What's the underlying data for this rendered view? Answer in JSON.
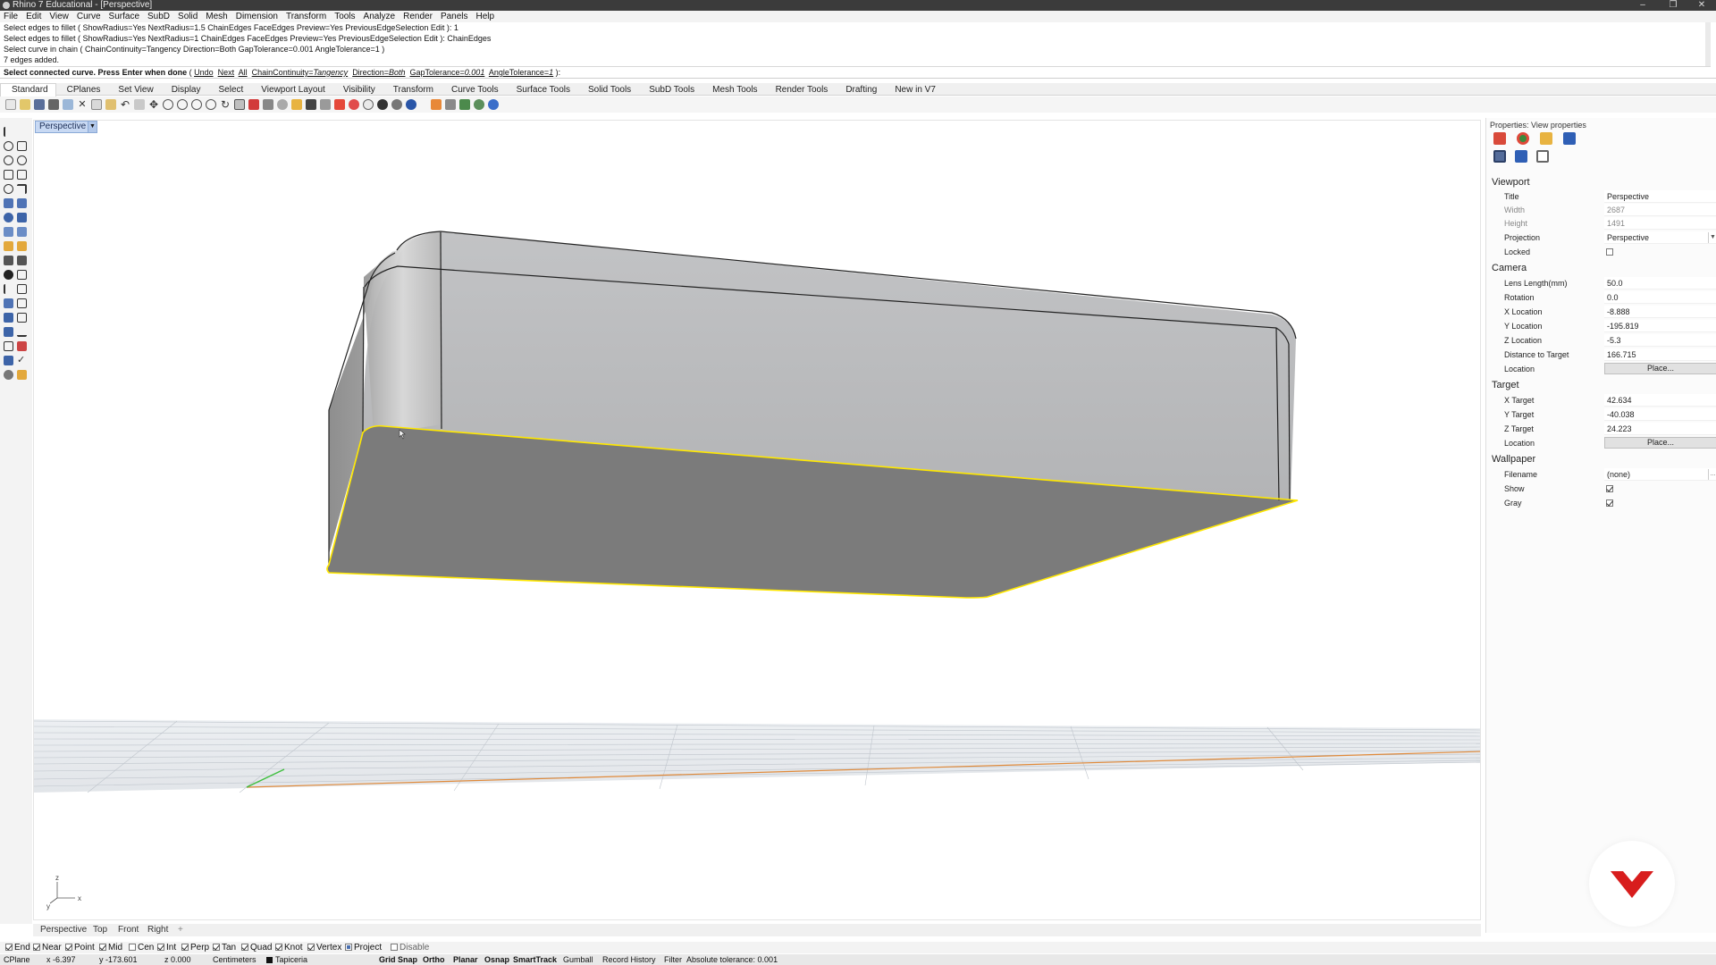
{
  "titlebar": {
    "title": "Rhino 7 Educational - [Perspective]"
  },
  "menu": [
    "File",
    "Edit",
    "View",
    "Curve",
    "Surface",
    "SubD",
    "Solid",
    "Mesh",
    "Dimension",
    "Transform",
    "Tools",
    "Analyze",
    "Render",
    "Panels",
    "Help"
  ],
  "command_history": [
    "Select edges to fillet ( ShowRadius=Yes  NextRadius=1.5  ChainEdges  FaceEdges  Preview=Yes  PreviousEdgeSelection  Edit ): 1",
    "Select edges to fillet ( ShowRadius=Yes  NextRadius=1  ChainEdges  FaceEdges  Preview=Yes  PreviousEdgeSelection  Edit ): ChainEdges",
    "Select curve in chain ( ChainContinuity=Tangency  Direction=Both  GapTolerance=0.001  AngleTolerance=1 )",
    "7 edges added."
  ],
  "command_prompt": {
    "prefix": "Select connected curve. Press Enter when done",
    "opt_undo": "Undo",
    "opt_next": "Next",
    "opt_all": "All",
    "opt_chain": "ChainContinuity=",
    "chain_val": "Tangency",
    "opt_dir": "Direction=",
    "dir_val": "Both",
    "opt_gap": "GapTolerance=",
    "gap_val": "0.001",
    "opt_angle": "AngleTolerance=",
    "angle_val": "1",
    "suffix": " ):"
  },
  "tool_tabs": [
    "Standard",
    "CPlanes",
    "Set View",
    "Display",
    "Select",
    "Viewport Layout",
    "Visibility",
    "Transform",
    "Curve Tools",
    "Surface Tools",
    "Solid Tools",
    "SubD Tools",
    "Mesh Tools",
    "Render Tools",
    "Drafting",
    "New in V7"
  ],
  "viewport": {
    "title": "Perspective",
    "axis_x": "x",
    "axis_y": "y",
    "axis_z": "z",
    "edge_color": "#ffe800",
    "tabs": [
      "Perspective",
      "Top",
      "Front",
      "Right"
    ],
    "add_tab": "+"
  },
  "osnaps": [
    {
      "label": "End",
      "checked": true
    },
    {
      "label": "Near",
      "checked": true
    },
    {
      "label": "Point",
      "checked": true
    },
    {
      "label": "Mid",
      "checked": true
    },
    {
      "label": "Cen",
      "checked": false
    },
    {
      "label": "Int",
      "checked": true
    },
    {
      "label": "Perp",
      "checked": true
    },
    {
      "label": "Tan",
      "checked": true
    },
    {
      "label": "Quad",
      "checked": true
    },
    {
      "label": "Knot",
      "checked": true
    },
    {
      "label": "Vertex",
      "checked": true
    },
    {
      "label": "Project",
      "checked": true
    },
    {
      "label": "Disable",
      "checked": false
    }
  ],
  "status": {
    "cplane": "CPlane",
    "x": "x -6.397",
    "y": "y -173.601",
    "z": "z 0.000",
    "units": "Centimeters",
    "layer": "Tapiceria",
    "grid_snap": "Grid Snap",
    "ortho": "Ortho",
    "planar": "Planar",
    "osnap": "Osnap",
    "smarttrack": "SmartTrack",
    "gumball": "Gumball",
    "record_history": "Record History",
    "filter": "Filter",
    "tolerance": "Absolute tolerance: 0.001"
  },
  "properties": {
    "header": "Properties: View properties",
    "viewport_section": "Viewport",
    "title_label": "Title",
    "title_value": "Perspective",
    "width_label": "Width",
    "width_value": "2687",
    "height_label": "Height",
    "height_value": "1491",
    "projection_label": "Projection",
    "projection_value": "Perspective",
    "locked_label": "Locked",
    "locked": false,
    "camera_section": "Camera",
    "lens_label": "Lens Length(mm)",
    "lens_value": "50.0",
    "rotation_label": "Rotation",
    "rotation_value": "0.0",
    "xloc_label": "X Location",
    "xloc_value": "-8.888",
    "yloc_label": "Y Location",
    "yloc_value": "-195.819",
    "zloc_label": "Z Location",
    "zloc_value": "-5.3",
    "dist_label": "Distance to Target",
    "dist_value": "166.715",
    "cam_location_label": "Location",
    "place_button": "Place...",
    "target_section": "Target",
    "xt_label": "X Target",
    "xt_value": "42.634",
    "yt_label": "Y Target",
    "yt_value": "-40.038",
    "zt_label": "Z Target",
    "zt_value": "24.223",
    "tgt_location_label": "Location",
    "wallpaper_section": "Wallpaper",
    "filename_label": "Filename",
    "filename_value": "(none)",
    "browse_button": "...",
    "show_label": "Show",
    "show": true,
    "gray_label": "Gray",
    "gray": true
  },
  "colors": {
    "logo_red": "#d81d1d",
    "selection_yellow": "#ffe800",
    "viewport_tab": "#c8d9f3"
  }
}
